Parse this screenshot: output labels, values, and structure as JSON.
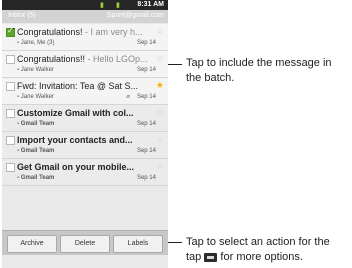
{
  "status_bar": {
    "time": "8:31 AM"
  },
  "title_bar": {
    "left": "Inbox (5)",
    "right": "Sprint@gmail.com"
  },
  "messages": [
    {
      "subject": "Congratulations!",
      "snippet": " - I am very h...",
      "sender": "Jane, Me (3)",
      "date": "Sep 14",
      "checked": true,
      "starred": false
    },
    {
      "subject": "Congratulations!!",
      "snippet": " - Hello LGOp...",
      "sender": "Jane Walker",
      "date": "Sep 14",
      "checked": false,
      "starred": false
    },
    {
      "subject": "Fwd: Invitation: Tea @ Sat S...",
      "snippet": "",
      "sender": "Jane Walker",
      "date": "Sep 14",
      "checked": false,
      "starred": true,
      "attachment": true
    },
    {
      "subject": "Customize Gmail with col...",
      "snippet": "",
      "sender": "Gmail Team",
      "date": "Sep 14",
      "checked": false,
      "starred": false
    },
    {
      "subject": "Import your contacts and...",
      "snippet": "",
      "sender": "Gmail Team",
      "date": "Sep 14",
      "checked": false,
      "starred": false
    },
    {
      "subject": "Get Gmail on your mobile...",
      "snippet": "",
      "sender": "Gmail Team",
      "date": "Sep 14",
      "checked": false,
      "starred": false
    }
  ],
  "actions": {
    "archive": "Archive",
    "delete": "Delete",
    "labels": "Labels"
  },
  "annotations": {
    "top_line1": "Tap to include the message in",
    "top_line2": "the batch.",
    "bottom_line1": "Tap to select an action for the",
    "bottom_line2_pre": "tap",
    "bottom_line2_post": "for more options."
  },
  "colors": {
    "checkbox_checked": "#5ea62b",
    "star_on": "#f0b400"
  },
  "icons": {
    "menu": "menu-key-icon",
    "star": "star-icon",
    "attachment": "paperclip-icon"
  }
}
